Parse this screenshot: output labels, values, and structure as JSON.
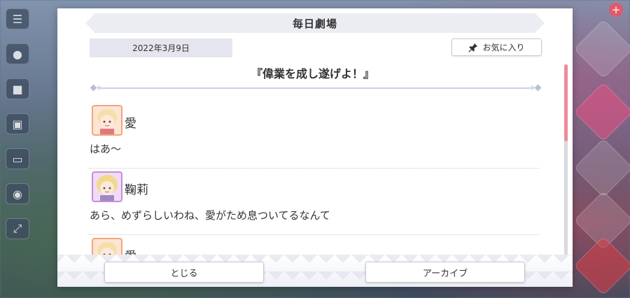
{
  "header": {
    "title": "毎日劇場"
  },
  "date": "2022年3月9日",
  "favorite_button": {
    "label": "お気に入り",
    "icon": "pin-icon"
  },
  "episode": {
    "title": "『偉業を成し遂げよ！』"
  },
  "dialogue": [
    {
      "speaker": "愛",
      "text": "はあ〜",
      "avatar": "ai-avatar",
      "frame_color": "#f4a57e"
    },
    {
      "speaker": "鞠莉",
      "text": "あら、めずらしいわね、愛がため息ついてるなんて",
      "avatar": "mari-avatar",
      "frame_color": "#c98bd8"
    },
    {
      "speaker": "愛",
      "text": "",
      "avatar": "ai-avatar",
      "frame_color": "#f4a57e"
    }
  ],
  "scroll_position": 0.0,
  "footer": {
    "close_label": "とじる",
    "archive_label": "アーカイブ"
  },
  "colors": {
    "accent_pink": "#f08a98",
    "header_bg": "#ecedf3"
  }
}
